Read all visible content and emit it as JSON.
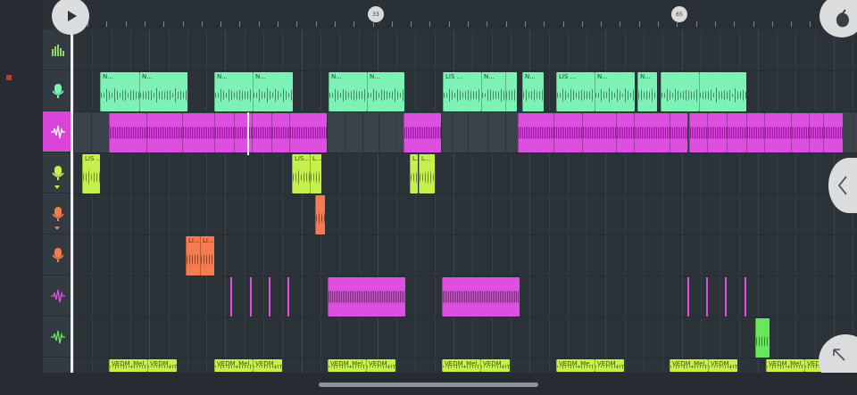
{
  "ruler": {
    "markers": [
      {
        "label": "33"
      },
      {
        "label": "65"
      }
    ]
  },
  "tracks": [
    {
      "icon": "mixer-bars-icon",
      "color": "#8fd66b"
    },
    {
      "icon": "microphone-icon",
      "color": "#7ef2b5"
    },
    {
      "icon": "waveform-icon",
      "color": "#ffffff",
      "selected": true
    },
    {
      "icon": "microphone-icon",
      "color": "#c6f14d"
    },
    {
      "icon": "microphone-icon",
      "color": "#f47c50"
    },
    {
      "icon": "microphone-icon",
      "color": "#f47c50"
    },
    {
      "icon": "waveform-icon",
      "color": "#dd4fdf"
    },
    {
      "icon": "waveform-icon",
      "color": "#66e85a"
    }
  ],
  "clips": {
    "mint": [
      "N...",
      "N...",
      "N...",
      "N...",
      "N...",
      "N...",
      "LIS ...",
      "N...",
      "N...",
      "LIS ...",
      "N...",
      "N..."
    ],
    "lime": [
      "LIS ...",
      "LIS...",
      "L...",
      "L...",
      "L..."
    ],
    "orange": [
      "LI...",
      "LI..."
    ],
    "bottom": [
      "VEDM_Mel...",
      "VEDM_...",
      "VEDM_Mel...",
      "VEDM_...",
      "VEDM_Mel...",
      "VEDM_...",
      "VEDM_Mel...",
      "VEDM_...",
      "VEDM_Me...",
      "VEDM_...",
      "VEDM_Mel...",
      "VEDM_...",
      "VEDM_Mel...",
      "VEDM_..."
    ]
  },
  "colors": {
    "mint": "#7ef2b5",
    "magenta": "#dd4fdf",
    "lime": "#c6f14d",
    "orange": "#f47c50",
    "green": "#66e85a"
  }
}
